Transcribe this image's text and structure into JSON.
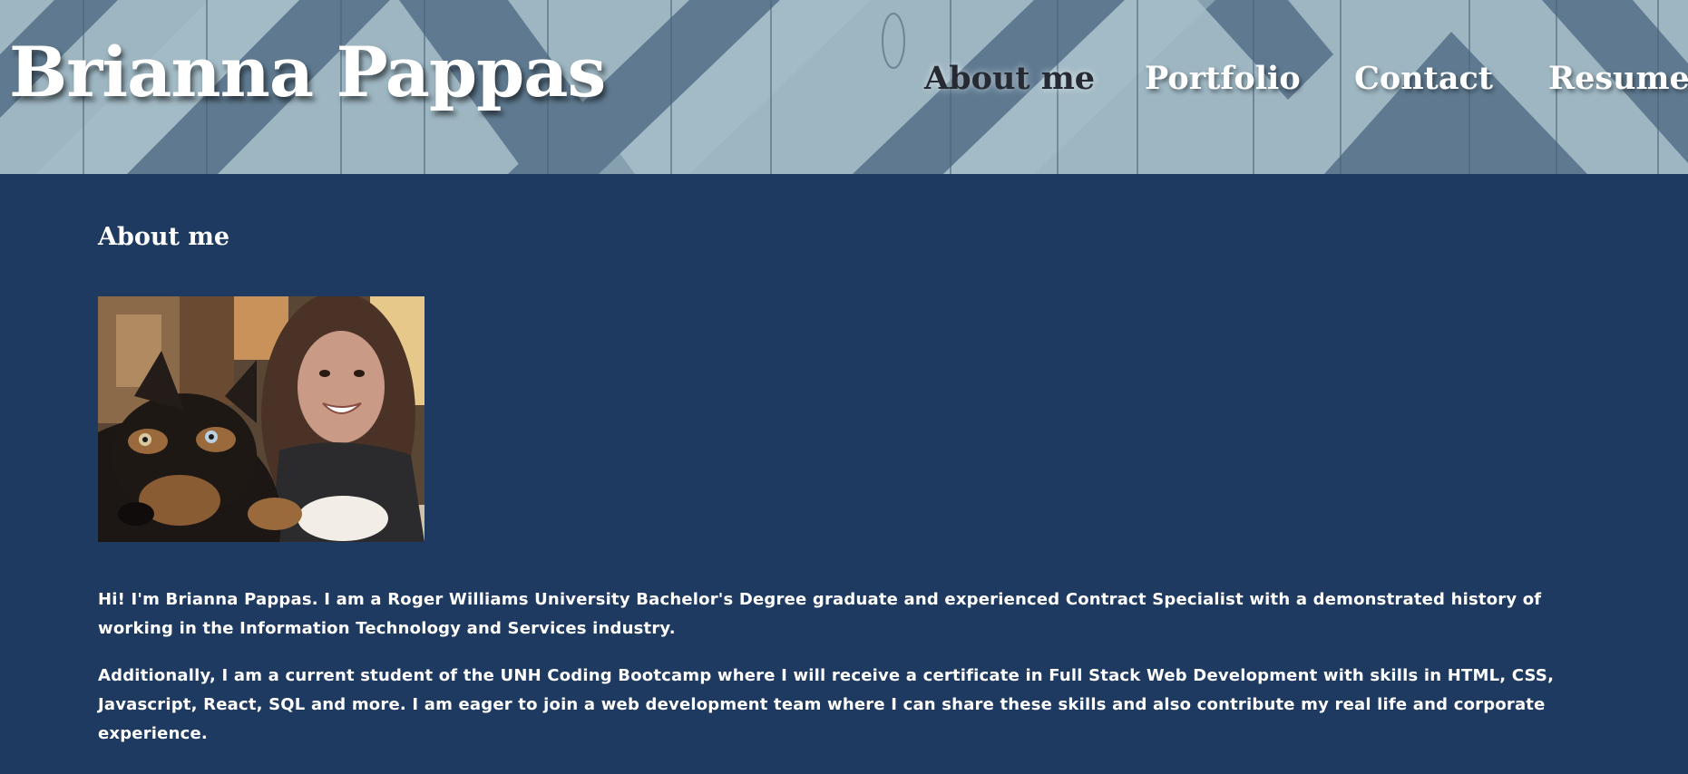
{
  "header": {
    "site_title": "Brianna Pappas",
    "nav": [
      {
        "label": "About me",
        "active": true
      },
      {
        "label": "Portfolio",
        "active": false
      },
      {
        "label": "Contact",
        "active": false
      },
      {
        "label": "Resume",
        "active": false
      }
    ]
  },
  "main": {
    "heading": "About me",
    "bio": [
      "Hi! I'm Brianna Pappas. I am a Roger Williams University Bachelor's Degree graduate and experienced Contract Specialist with a demonstrated history of working in the Information Technology and Services industry.",
      "Additionally, I am a current student of the UNH Coding Bootcamp where I will receive a certificate in Full Stack Web Development with skills in HTML, CSS, Javascript, React, SQL and more. I am eager to join a web development team where I can share these skills and also contribute my real life and corporate experience."
    ]
  },
  "colors": {
    "page_background": "#1f3a60",
    "header_light_wood": "#9db6c2",
    "header_dark_wood": "#5f7a90",
    "active_nav_text": "#262b33",
    "text": "#ffffff"
  }
}
